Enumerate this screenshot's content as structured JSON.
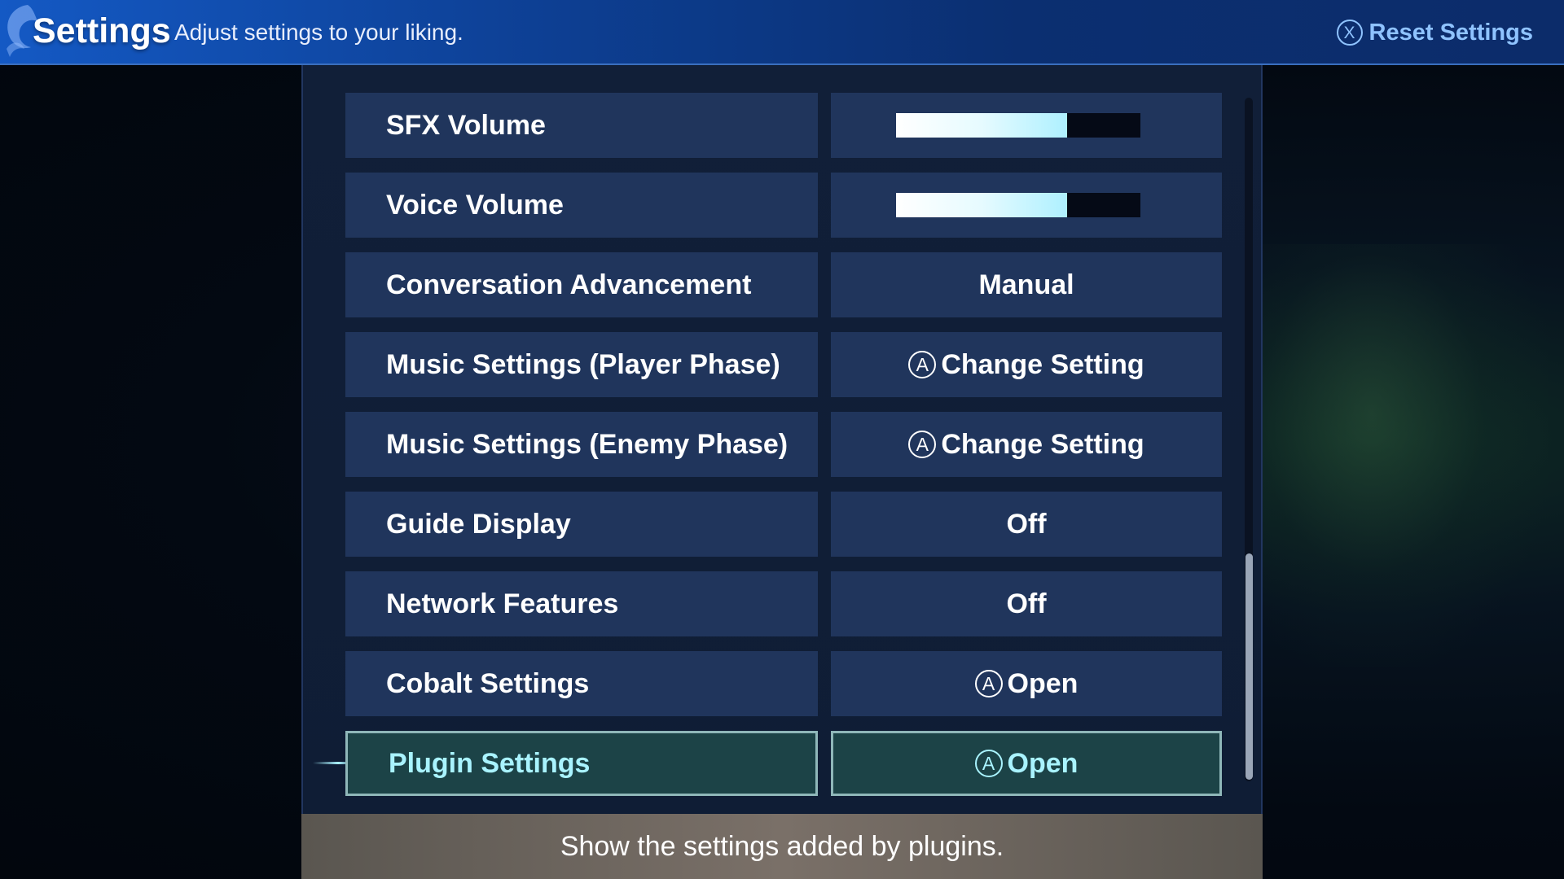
{
  "header": {
    "title": "Settings",
    "subtitle": "Adjust settings to your liking.",
    "reset_glyph": "X",
    "reset_label": "Reset Settings"
  },
  "settings": [
    {
      "label": "SFX Volume",
      "type": "slider",
      "level": 0.7
    },
    {
      "label": "Voice Volume",
      "type": "slider",
      "level": 0.7
    },
    {
      "label": "Conversation Advancement",
      "type": "value",
      "value": "Manual"
    },
    {
      "label": "Music Settings (Player Phase)",
      "type": "button",
      "glyph": "A",
      "value": "Change Setting"
    },
    {
      "label": "Music Settings (Enemy Phase)",
      "type": "button",
      "glyph": "A",
      "value": "Change Setting"
    },
    {
      "label": "Guide Display",
      "type": "value",
      "value": "Off"
    },
    {
      "label": "Network Features",
      "type": "value",
      "value": "Off"
    },
    {
      "label": "Cobalt Settings",
      "type": "button",
      "glyph": "A",
      "value": "Open"
    },
    {
      "label": "Plugin Settings",
      "type": "button",
      "glyph": "A",
      "value": "Open",
      "selected": true
    }
  ],
  "footer": {
    "description": "Show the settings added by plugins."
  },
  "colors": {
    "header_blue": "#1459c4",
    "row_bg": "#20355c",
    "selected_bg": "#1c4347",
    "selected_text": "#a9f3ff",
    "reset_text": "#8fc3ff"
  }
}
